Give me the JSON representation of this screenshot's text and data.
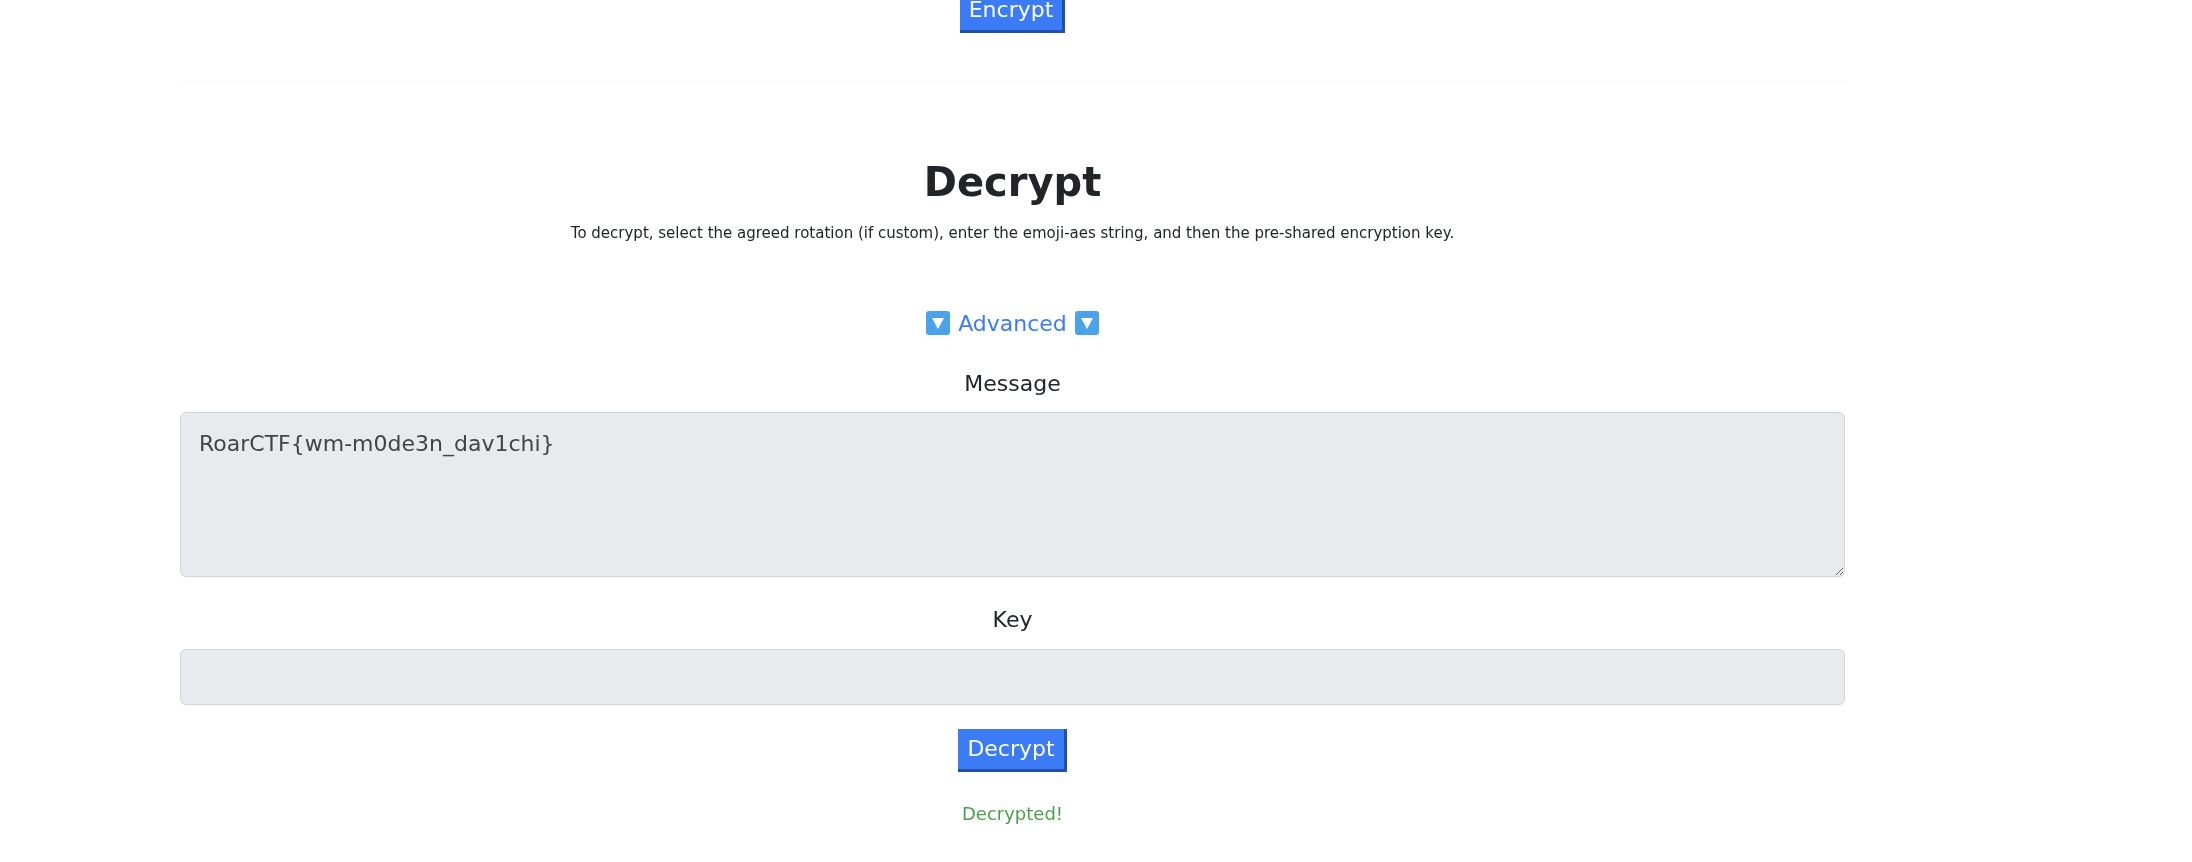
{
  "encrypt_button": "Encrypt",
  "decrypt_section": {
    "title": "Decrypt",
    "description": "To decrypt, select the agreed rotation (if custom), enter the emoji-aes string, and then the pre-shared encryption key.",
    "advanced_toggle": {
      "label": "Advanced"
    },
    "message": {
      "label": "Message",
      "value": "RoarCTF{wm-m0de3n_dav1chi}"
    },
    "key": {
      "label": "Key"
    },
    "button": "Decrypt",
    "status": {
      "kind": "success",
      "text": "Decrypted!"
    }
  }
}
